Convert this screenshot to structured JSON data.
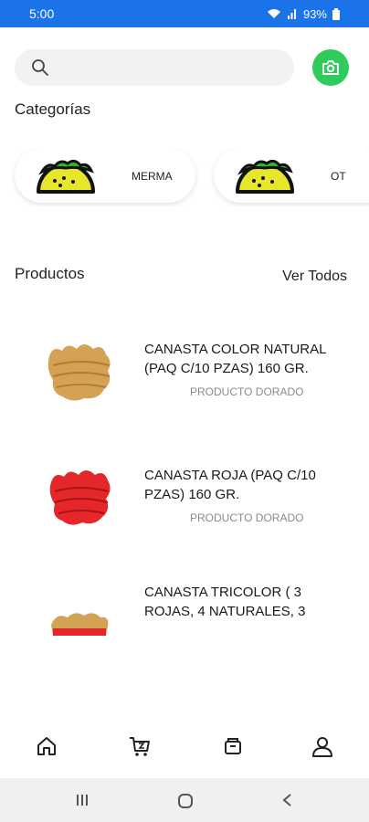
{
  "status_bar": {
    "time": "5:00",
    "battery": "93%"
  },
  "search": {
    "placeholder": "",
    "value": ""
  },
  "categories": {
    "title": "Categorías",
    "items": [
      {
        "label": "MERMA",
        "icon": "taco-icon"
      },
      {
        "label": "OT",
        "icon": "taco-icon"
      }
    ]
  },
  "products": {
    "title": "Productos",
    "see_all": "Ver Todos",
    "items": [
      {
        "name": "CANASTA COLOR NATURAL (PAQ C/10 PZAS) 160 GR.",
        "tag": "PRODUCTO DORADO"
      },
      {
        "name": "CANASTA ROJA  (PAQ C/10 PZAS) 160 GR.",
        "tag": "PRODUCTO DORADO"
      },
      {
        "name": "CANASTA TRICOLOR ( 3 ROJAS, 4 NATURALES, 3",
        "tag": ""
      }
    ]
  },
  "bottom_nav": {
    "items": [
      {
        "icon": "home-icon"
      },
      {
        "icon": "cart-icon"
      },
      {
        "icon": "orders-icon"
      },
      {
        "icon": "profile-icon"
      }
    ]
  },
  "colors": {
    "status_bar": "#1a73e8",
    "accent_green": "#2ecc5a",
    "muted_text": "#8a8a8a"
  }
}
